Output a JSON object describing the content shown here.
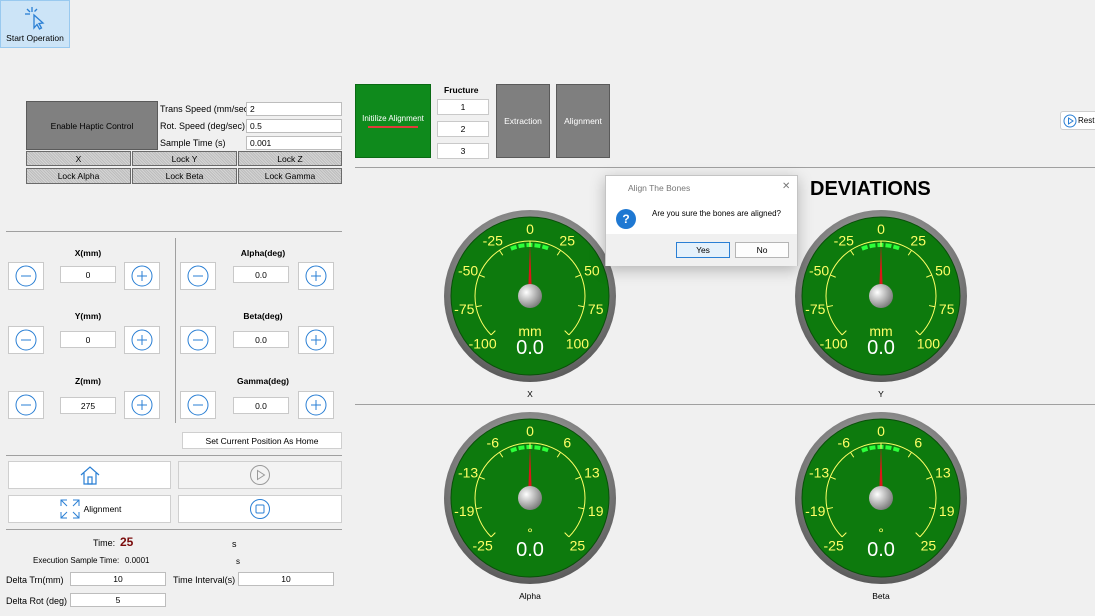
{
  "toolbar": {
    "start_label": "Start Operation"
  },
  "haptic": {
    "enable_label": "Enable Haptic Control",
    "trans_speed_label": "Trans Speed (mm/sec)",
    "trans_speed_value": "2",
    "rot_speed_label": "Rot. Speed (deg/sec)",
    "rot_speed_value": "0.5",
    "sample_time_label": "Sample Time (s)",
    "sample_time_value": "0.001"
  },
  "locks": [
    "X",
    "Lock Y",
    "Lock Z",
    "Lock Alpha",
    "Lock Beta",
    "Lock Gamma"
  ],
  "axes": {
    "x_label": "X(mm)",
    "x_value": "0",
    "y_label": "Y(mm)",
    "y_value": "0",
    "z_label": "Z(mm)",
    "z_value": "275",
    "alpha_label": "Alpha(deg)",
    "alpha_value": "0.0",
    "beta_label": "Beta(deg)",
    "beta_value": "0.0",
    "gamma_label": "Gamma(deg)",
    "gamma_value": "0.0"
  },
  "home_button_label": "Set Current Position As Home",
  "alignment_button_label": "Alignment",
  "status": {
    "time_label": "Time:",
    "time_value": "25",
    "time_unit": "s",
    "exec_label": "Execution Sample Time:",
    "exec_value": "0.0001",
    "exec_unit": "s",
    "delta_trn_label": "Delta Trn(mm)",
    "delta_trn_value": "10",
    "time_interval_label": "Time Interval(s)",
    "time_interval_value": "10",
    "delta_rot_label": "Delta Rot (deg)",
    "delta_rot_value": "5"
  },
  "procedure": {
    "init_label": "Initilize Alignment",
    "fructure_label": "Fructure",
    "fructures": [
      "1",
      "2",
      "3"
    ],
    "extraction_label": "Extraction",
    "alignment_label": "Alignment"
  },
  "right_button_label": "Rest",
  "deviations_title": "DEVIATIONS",
  "gauges": [
    {
      "name": "X",
      "unit": "mm",
      "value": "0.0",
      "ticks": [
        "-100",
        "-75",
        "-50",
        "-25",
        "0",
        "25",
        "50",
        "75",
        "100"
      ]
    },
    {
      "name": "Y",
      "unit": "mm",
      "value": "0.0",
      "ticks": [
        "-100",
        "-75",
        "-50",
        "-25",
        "0",
        "25",
        "50",
        "75",
        "100"
      ]
    },
    {
      "name": "Alpha",
      "unit": "°",
      "value": "0.0",
      "ticks": [
        "-25",
        "-19",
        "-13",
        "-6",
        "0",
        "6",
        "13",
        "19",
        "25"
      ]
    },
    {
      "name": "Beta",
      "unit": "°",
      "value": "0.0",
      "ticks": [
        "-25",
        "-19",
        "-13",
        "-6",
        "0",
        "6",
        "13",
        "19",
        "25"
      ]
    }
  ],
  "dialog": {
    "title": "Align The Bones",
    "message": "Are you sure the bones are aligned?",
    "yes_label": "Yes",
    "no_label": "No",
    "close_glyph": "✕",
    "icon_glyph": "?"
  },
  "colors": {
    "accent_green": "#0f8a1c",
    "gauge_green": "#0d7a0d",
    "tick_yellow": "#ffff66",
    "needle_red": "#d81818"
  }
}
